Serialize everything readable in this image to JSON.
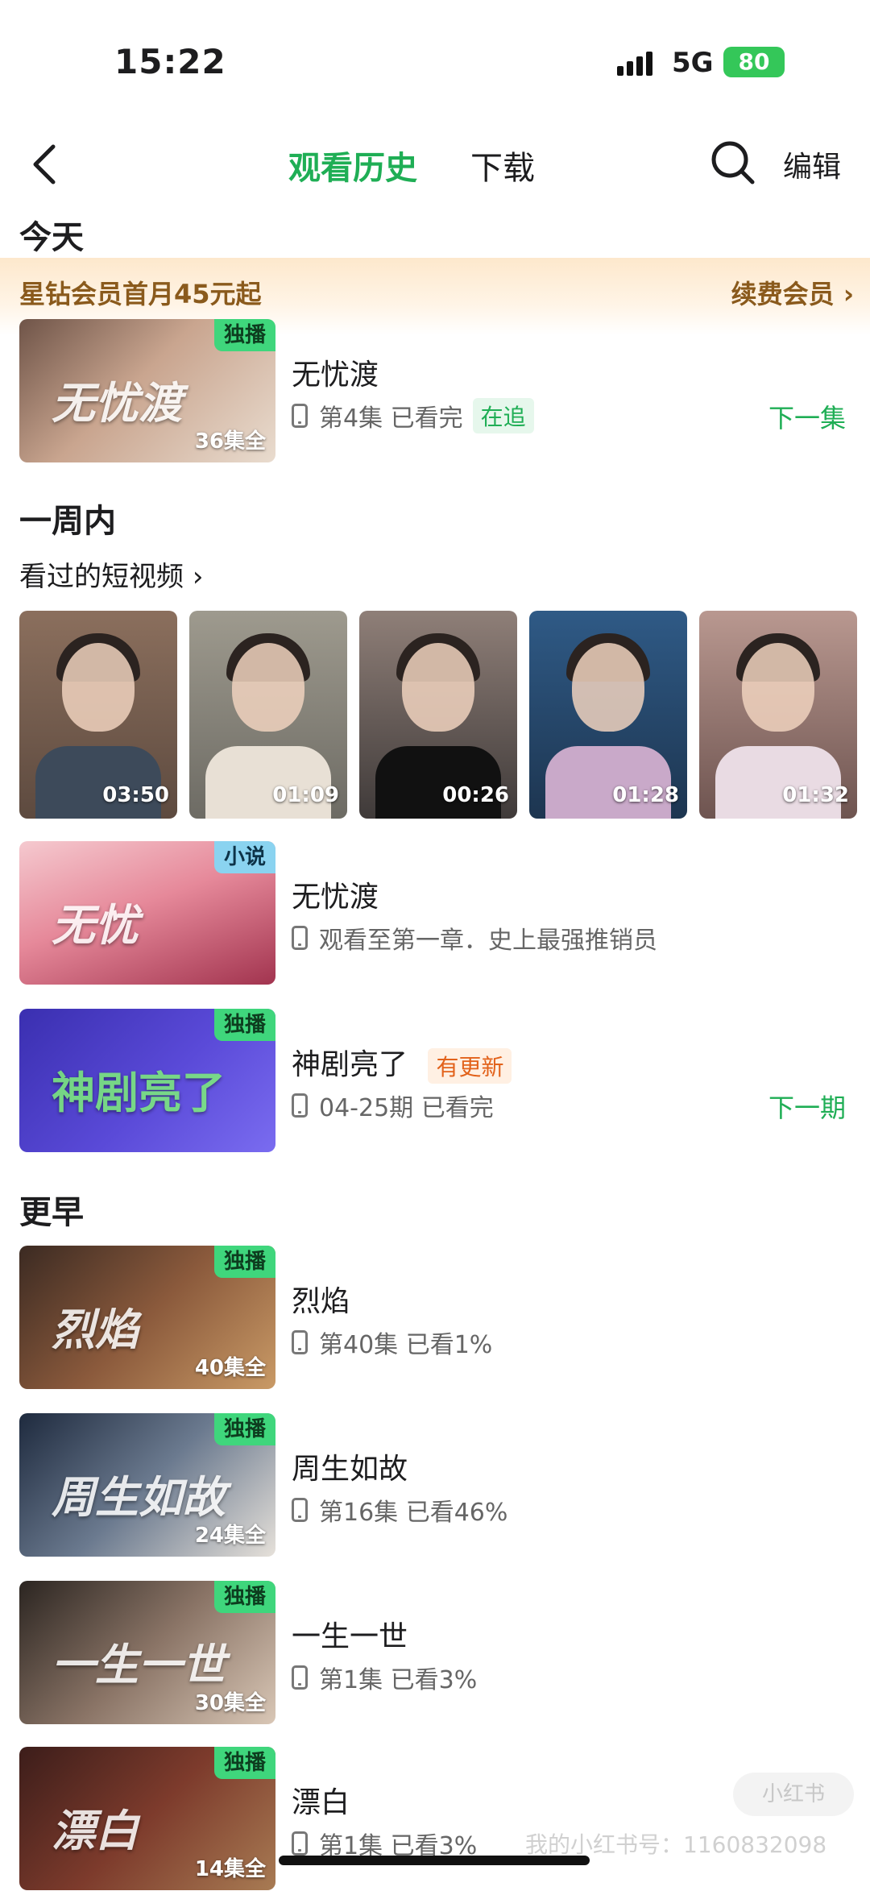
{
  "status": {
    "time": "15:22",
    "network": "5G",
    "battery": "80"
  },
  "nav": {
    "tab_history": "观看历史",
    "tab_download": "下载",
    "edit": "编辑"
  },
  "sections": {
    "today": "今天",
    "week": "一周内",
    "earlier": "更早"
  },
  "promo": {
    "text": "星钻会员首月45元起",
    "link": "续费会员"
  },
  "today_items": [
    {
      "title": "无忧渡",
      "progress": "第4集 已看完",
      "tag": "在追",
      "badge": "独播",
      "count": "36集全",
      "cover_text": "无忧渡",
      "action": "下一集"
    }
  ],
  "shorts": {
    "label": "看过的短视频",
    "items": [
      {
        "duration": "03:50"
      },
      {
        "duration": "01:09"
      },
      {
        "duration": "00:26"
      },
      {
        "duration": "01:28"
      },
      {
        "duration": "01:32"
      }
    ]
  },
  "week_items": [
    {
      "title": "无忧渡",
      "progress": "观看至第一章．史上最强推销员",
      "badge": "小说",
      "cover_text": "无忧"
    },
    {
      "title": "神剧亮了",
      "tag": "有更新",
      "progress": "04-25期 已看完",
      "badge": "独播",
      "cover_text": "神剧亮了",
      "action": "下一期"
    }
  ],
  "earlier_items": [
    {
      "title": "烈焰",
      "progress": "第40集 已看1%",
      "badge": "独播",
      "count": "40集全",
      "cover_text": "烈焰"
    },
    {
      "title": "周生如故",
      "progress": "第16集 已看46%",
      "badge": "独播",
      "count": "24集全",
      "cover_text": "周生如故"
    },
    {
      "title": "一生一世",
      "progress": "第1集 已看3%",
      "badge": "独播",
      "count": "30集全",
      "cover_text": "一生一世"
    },
    {
      "title": "漂白",
      "progress": "第1集 已看3%",
      "badge": "独播",
      "count": "14集全",
      "cover_text": "漂白"
    }
  ],
  "watermark": {
    "text": "我的小红书号：1160832098",
    "logo": "小红书"
  },
  "colors": {
    "accent": "#1fae55",
    "promo_text": "#8a5a1c",
    "update_tag": "#e2621b"
  }
}
